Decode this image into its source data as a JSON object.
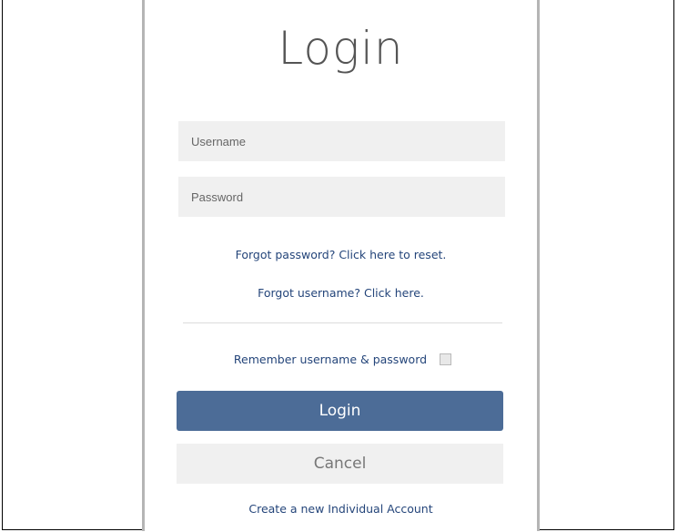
{
  "login_form": {
    "title": "Login",
    "username_placeholder": "Username",
    "password_placeholder": "Password",
    "forgot_password_link": "Forgot password? Click here to reset.",
    "forgot_username_link": "Forgot username? Click here.",
    "remember_label": "Remember username & password",
    "remember_checked": false,
    "login_button": "Login",
    "cancel_button": "Cancel",
    "create_account_link": "Create a new Individual Account"
  },
  "colors": {
    "accent": "#4c6c97",
    "link": "#24457a",
    "field_bg": "#f0f0f0"
  }
}
